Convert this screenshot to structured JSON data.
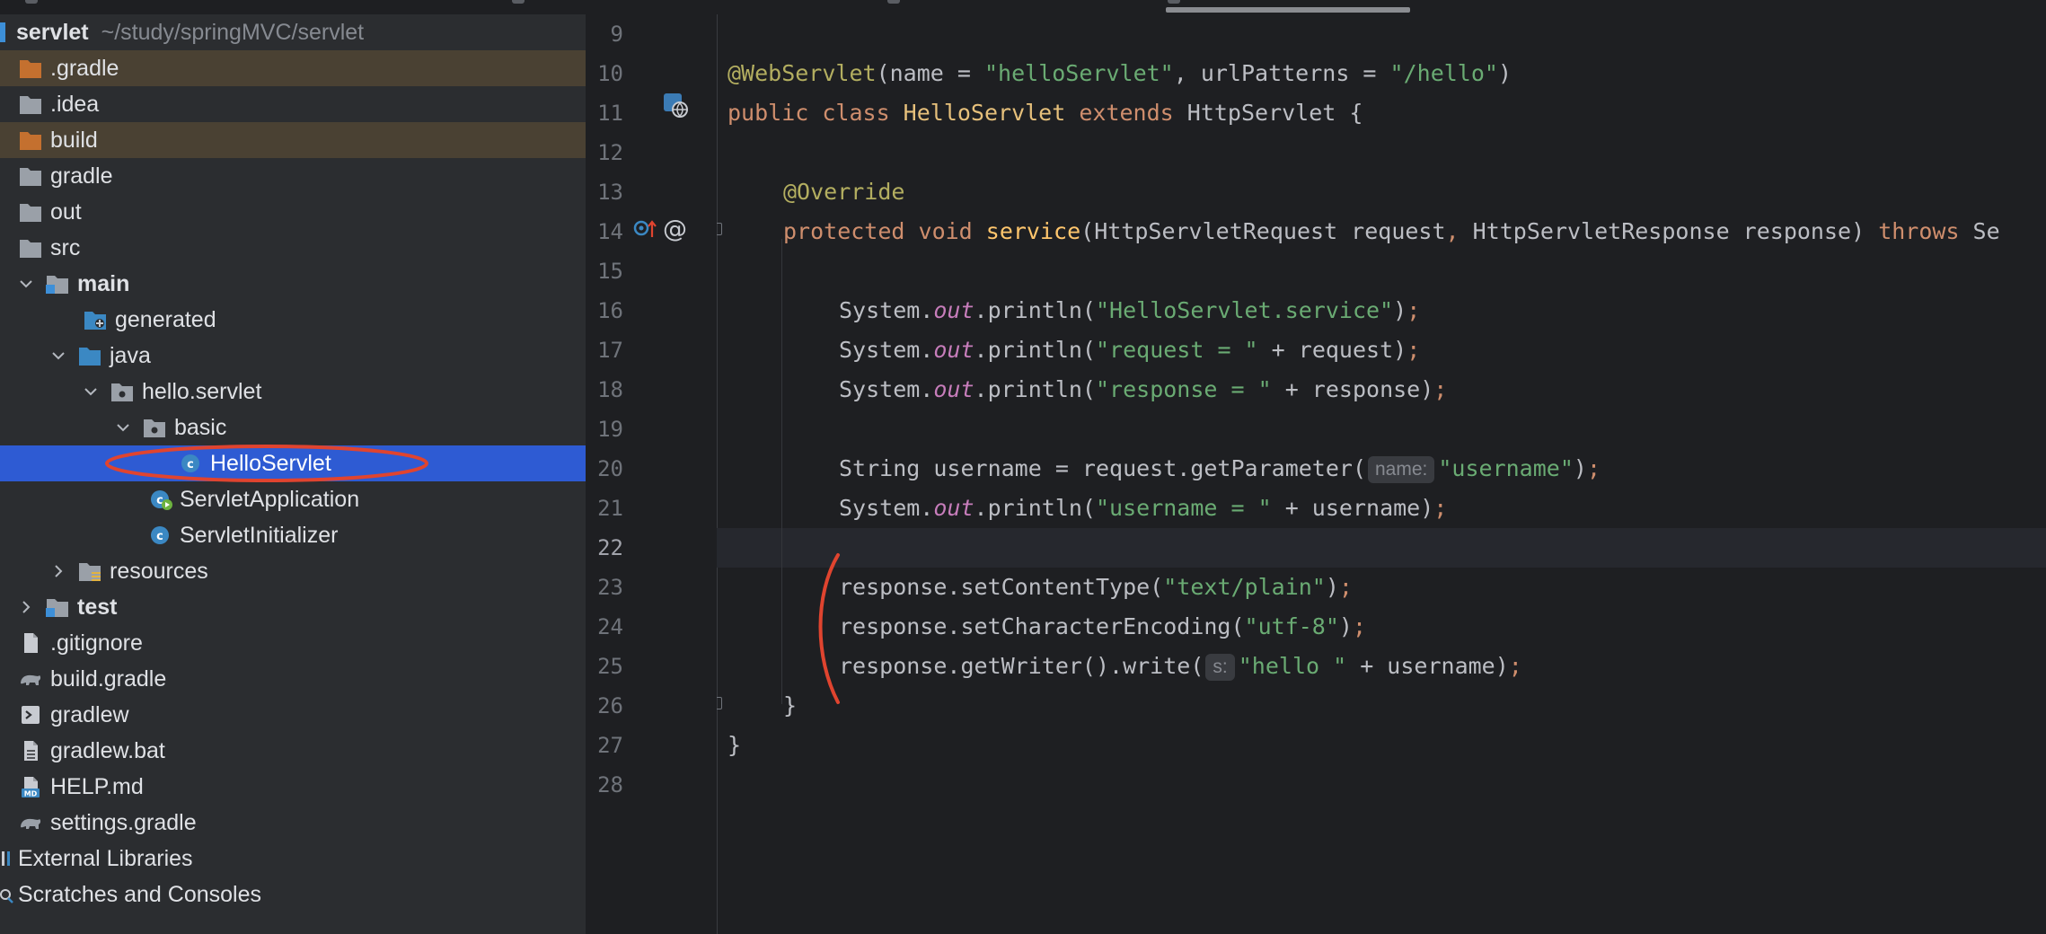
{
  "project": {
    "root_name": "servlet",
    "root_path": "~/study/springMVC/servlet",
    "items": [
      {
        "label": ".gradle"
      },
      {
        "label": ".idea"
      },
      {
        "label": "build"
      },
      {
        "label": "gradle"
      },
      {
        "label": "out"
      },
      {
        "label": "src"
      },
      {
        "label": "main"
      },
      {
        "label": "generated"
      },
      {
        "label": "java"
      },
      {
        "label": "hello.servlet"
      },
      {
        "label": "basic"
      },
      {
        "label": "HelloServlet"
      },
      {
        "label": "ServletApplication"
      },
      {
        "label": "ServletInitializer"
      },
      {
        "label": "resources"
      },
      {
        "label": "test"
      },
      {
        "label": ".gitignore"
      },
      {
        "label": "build.gradle"
      },
      {
        "label": "gradlew"
      },
      {
        "label": "gradlew.bat"
      },
      {
        "label": "HELP.md"
      },
      {
        "label": "settings.gradle"
      },
      {
        "label": "External Libraries"
      },
      {
        "label": "Scratches and Consoles"
      }
    ]
  },
  "editor": {
    "line_numbers": [
      "9",
      "10",
      "11",
      "12",
      "13",
      "14",
      "15",
      "16",
      "17",
      "18",
      "19",
      "20",
      "21",
      "22",
      "23",
      "24",
      "25",
      "26",
      "27",
      "28"
    ],
    "current_line": "22",
    "code": {
      "l10": {
        "ann": "@WebServlet",
        "p1": "(name = ",
        "s1": "\"helloServlet\"",
        "p2": ", urlPatterns = ",
        "s2": "\"/hello\"",
        "p3": ")"
      },
      "l11": {
        "k1": "public class ",
        "name": "HelloServlet ",
        "k2": "extends ",
        "rest": "HttpServlet {"
      },
      "l13": {
        "ann": "@Override"
      },
      "l14": {
        "k1": "protected void ",
        "fn": "service",
        "p1": "(HttpServletRequest request",
        "c1": ", ",
        "p2": "HttpServletResponse response) ",
        "k2": "throws ",
        "tail": "Se"
      },
      "l16": {
        "p1": "System.",
        "st": "out",
        "p2": ".println(",
        "s1": "\"HelloServlet.service\"",
        "p3": ")",
        "semi": ";"
      },
      "l17": {
        "p1": "System.",
        "st": "out",
        "p2": ".println(",
        "s1": "\"request = \"",
        "p3": " + request)",
        "semi": ";"
      },
      "l18": {
        "p1": "System.",
        "st": "out",
        "p2": ".println(",
        "s1": "\"response = \"",
        "p3": " + response)",
        "semi": ";"
      },
      "l20": {
        "p1": "String username = request.getParameter(",
        "hint": "name:",
        "s1": "\"username\"",
        "p3": ")",
        "semi": ";"
      },
      "l21": {
        "p1": "System.",
        "st": "out",
        "p2": ".println(",
        "s1": "\"username = \"",
        "p3": " + username)",
        "semi": ";"
      },
      "l23": {
        "p1": "response.setContentType(",
        "s1": "\"text/plain\"",
        "p3": ")",
        "semi": ";"
      },
      "l24": {
        "p1": "response.setCharacterEncoding(",
        "s1": "\"utf-8\"",
        "p3": ")",
        "semi": ";"
      },
      "l25": {
        "p1": "response.getWriter().write(",
        "hint": "s:",
        "s1": "\"hello \"",
        "p3": " + username)",
        "semi": ";"
      },
      "l26": {
        "p1": "}"
      },
      "l27": {
        "p1": "}"
      }
    }
  },
  "colors": {
    "accent_selection": "#2e5bd3",
    "highlight_row": "#4a4133",
    "annotation_red": "#e0442f",
    "keyword": "#cf8e6d",
    "string": "#6aab73",
    "function": "#56a8f5"
  },
  "icons": {
    "folder_orange": "folder-excluded-icon",
    "folder_gray": "folder-icon",
    "folder_source": "source-folder-icon",
    "package": "package-icon",
    "class": "java-class-icon",
    "spring_app": "spring-boot-app-icon",
    "gradle": "gradle-elephant-icon",
    "terminal": "shell-script-icon",
    "file": "text-file-icon",
    "markdown": "markdown-icon",
    "libraries": "libraries-icon",
    "scratches": "scratches-icon"
  }
}
